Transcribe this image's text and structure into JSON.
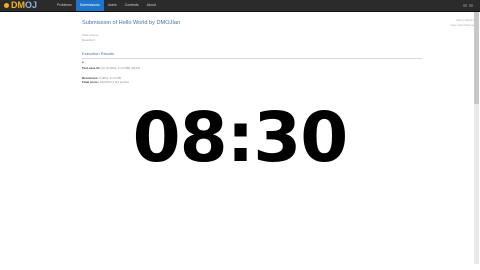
{
  "navbar": {
    "brand_primary": "DM",
    "brand_secondary": "OJ",
    "items": [
      {
        "label": "Problems",
        "active": false
      },
      {
        "label": "Submissions",
        "active": true
      },
      {
        "label": "Users",
        "active": false
      },
      {
        "label": "Contests",
        "active": false
      },
      {
        "label": "About",
        "active": false
      }
    ]
  },
  "page": {
    "title": "Submission of Hello World by DMOJIan",
    "meta_line_1": "View source",
    "meta_line_2": "Resubmit",
    "section_heading": "Execution Results",
    "bullet": "•",
    "test_case_label": "Test case #1:",
    "test_case_value": "AC [0.000s, 2.14 MB] (10/10)",
    "resources_label": "Resources:",
    "resources_value": "0.000s, 2.14 MB",
    "final_score_label": "Final score:",
    "final_score_value": "100/100 (1.0/1 points)"
  },
  "side_links": [
    "View problem",
    "View submissions"
  ],
  "overlay": {
    "timer": "08:30"
  },
  "colors": {
    "navbar_bg": "#2b2b2b",
    "nav_active": "#1d74c8",
    "brand_accent": "#f2b21b",
    "title": "#4a6fa5"
  }
}
